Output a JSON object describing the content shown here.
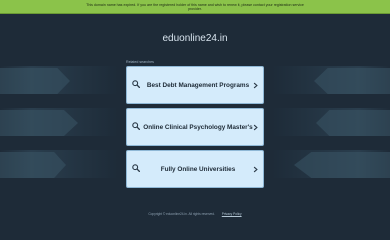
{
  "notice": {
    "line1": "This domain name has expired. If you are the registered holder of this name and wish to renew it, please contact your registration service",
    "line2": "provider."
  },
  "domain": "eduonline24.in",
  "related_label": "Related searches",
  "searches": [
    {
      "label": "Best Debt Management Programs",
      "icon": "search-icon"
    },
    {
      "label": "Online Clinical Psychology Master's",
      "icon": "search-icon"
    },
    {
      "label": "Fully Online Universities",
      "icon": "search-icon"
    }
  ],
  "footer": {
    "copyright": "Copyright © eduonline24.in.  All rights reserved.",
    "privacy": "Privacy Policy"
  },
  "colors": {
    "background": "#1e2b38",
    "notice_bg": "#8bc34a",
    "card_bg": "#d4ebfb"
  }
}
